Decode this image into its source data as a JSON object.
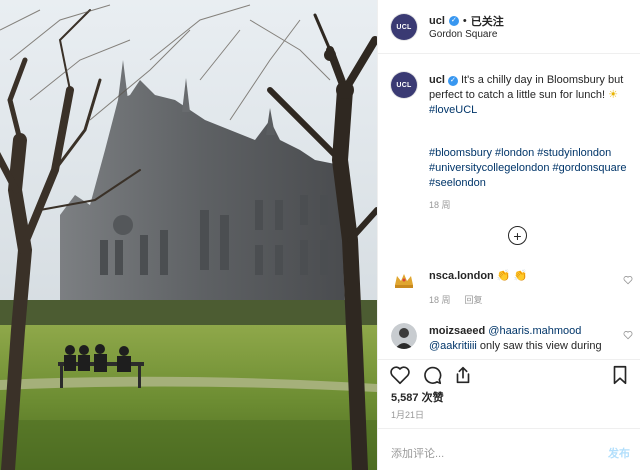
{
  "colors": {
    "link": "#003569",
    "verified": "#3897f0",
    "muted": "#999999",
    "post_disabled": "#b2dffc",
    "avatar_bg": "#3a3a73"
  },
  "photo": {
    "icon": "photo-of-gothic-building-in-park"
  },
  "header": {
    "avatar_text": "UCL",
    "username": "ucl",
    "verified_icon": "verified-badge-icon",
    "separator": "•",
    "follow_status": "已关注",
    "location": "Gordon Square"
  },
  "caption": {
    "avatar_text": "UCL",
    "username": "ucl",
    "text": " It's a chilly day in Bloomsbury but perfect to catch a little sun for lunch! ",
    "emoji": "☀",
    "inline_tag": "#loveUCL",
    "hashtags": "#bloomsbury #london #studyinlondon #universitycollegelondon #gordonsquare #seelondon",
    "age": "18 周"
  },
  "load_more_icon": "plus-circle-icon",
  "comments": [
    {
      "username": "nsca.london",
      "text": " 👏 👏",
      "age": "18 周",
      "reply_label": "回复",
      "avatar_icon": "crown-icon"
    },
    {
      "username": "moizsaeed",
      "mention1": " @haaris.mahmood",
      "mention2": "@aakritiiii",
      "text": " only saw this view during",
      "avatar_icon": "person-avatar"
    }
  ],
  "actions": {
    "like_icon": "heart-icon",
    "comment_icon": "comment-bubble-icon",
    "share_icon": "share-icon",
    "save_icon": "bookmark-icon"
  },
  "likes_text": "5,587 次赞",
  "date": "1月21日",
  "composer": {
    "placeholder": "添加评论...",
    "post_label": "发布"
  }
}
